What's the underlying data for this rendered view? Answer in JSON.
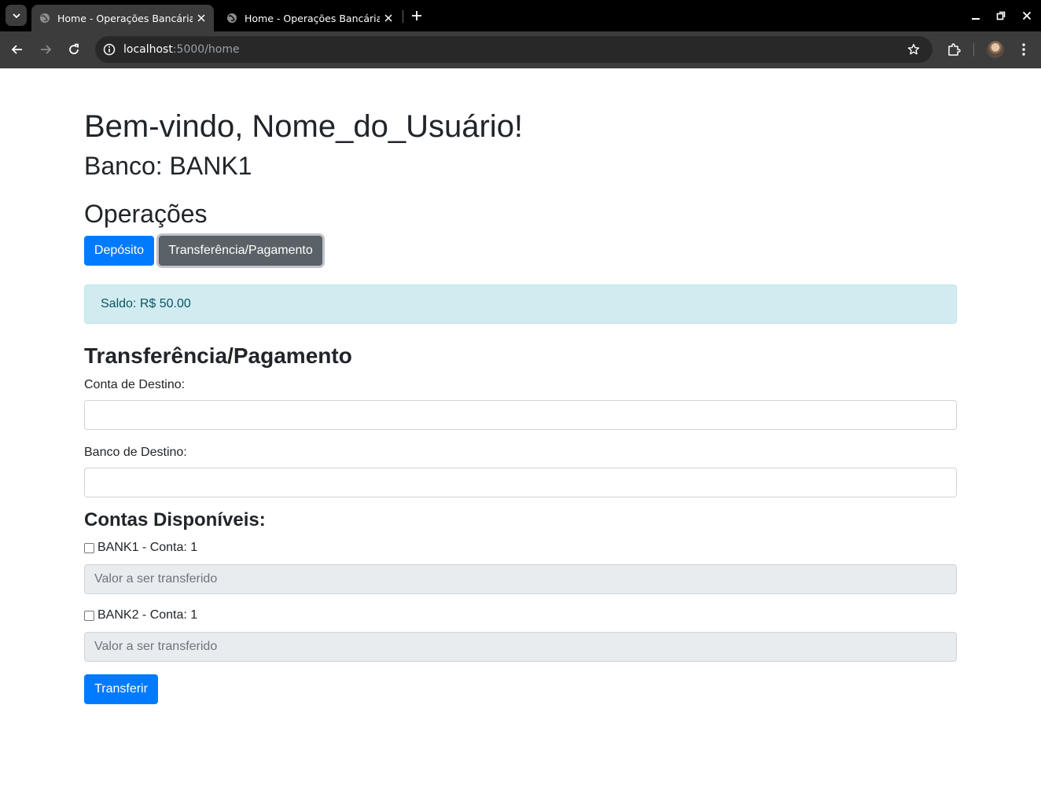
{
  "browser": {
    "tabs": [
      {
        "title": "Home - Operações Bancárias",
        "active": true
      },
      {
        "title": "Home - Operações Bancárias",
        "active": false
      }
    ],
    "url_host": "localhost",
    "url_rest": ":5000/home"
  },
  "page": {
    "welcome": "Bem-vindo, Nome_do_Usuário!",
    "bank": "Banco: BANK1",
    "operations_title": "Operações",
    "buttons": {
      "deposit": "Depósito",
      "transfer": "Transferência/Pagamento",
      "submit": "Transferir"
    },
    "balance": "Saldo: R$ 50.00",
    "transfer_section": {
      "title": "Transferência/Pagamento",
      "dest_account_label": "Conta de Destino:",
      "dest_account_value": "",
      "dest_bank_label": "Banco de Destino:",
      "dest_bank_value": "",
      "accounts_title": "Contas Disponíveis:",
      "accounts": [
        {
          "label": "BANK1 - Conta: 1",
          "checked": false,
          "placeholder": "Valor a ser transferido"
        },
        {
          "label": "BANK2 - Conta: 1",
          "checked": false,
          "placeholder": "Valor a ser transferido"
        }
      ]
    }
  },
  "colors": {
    "primary": "#007bff",
    "secondary": "#5a6268",
    "alert_bg": "#d1ecf1",
    "alert_text": "#0c5460",
    "disabled_input": "#e9ecef"
  }
}
